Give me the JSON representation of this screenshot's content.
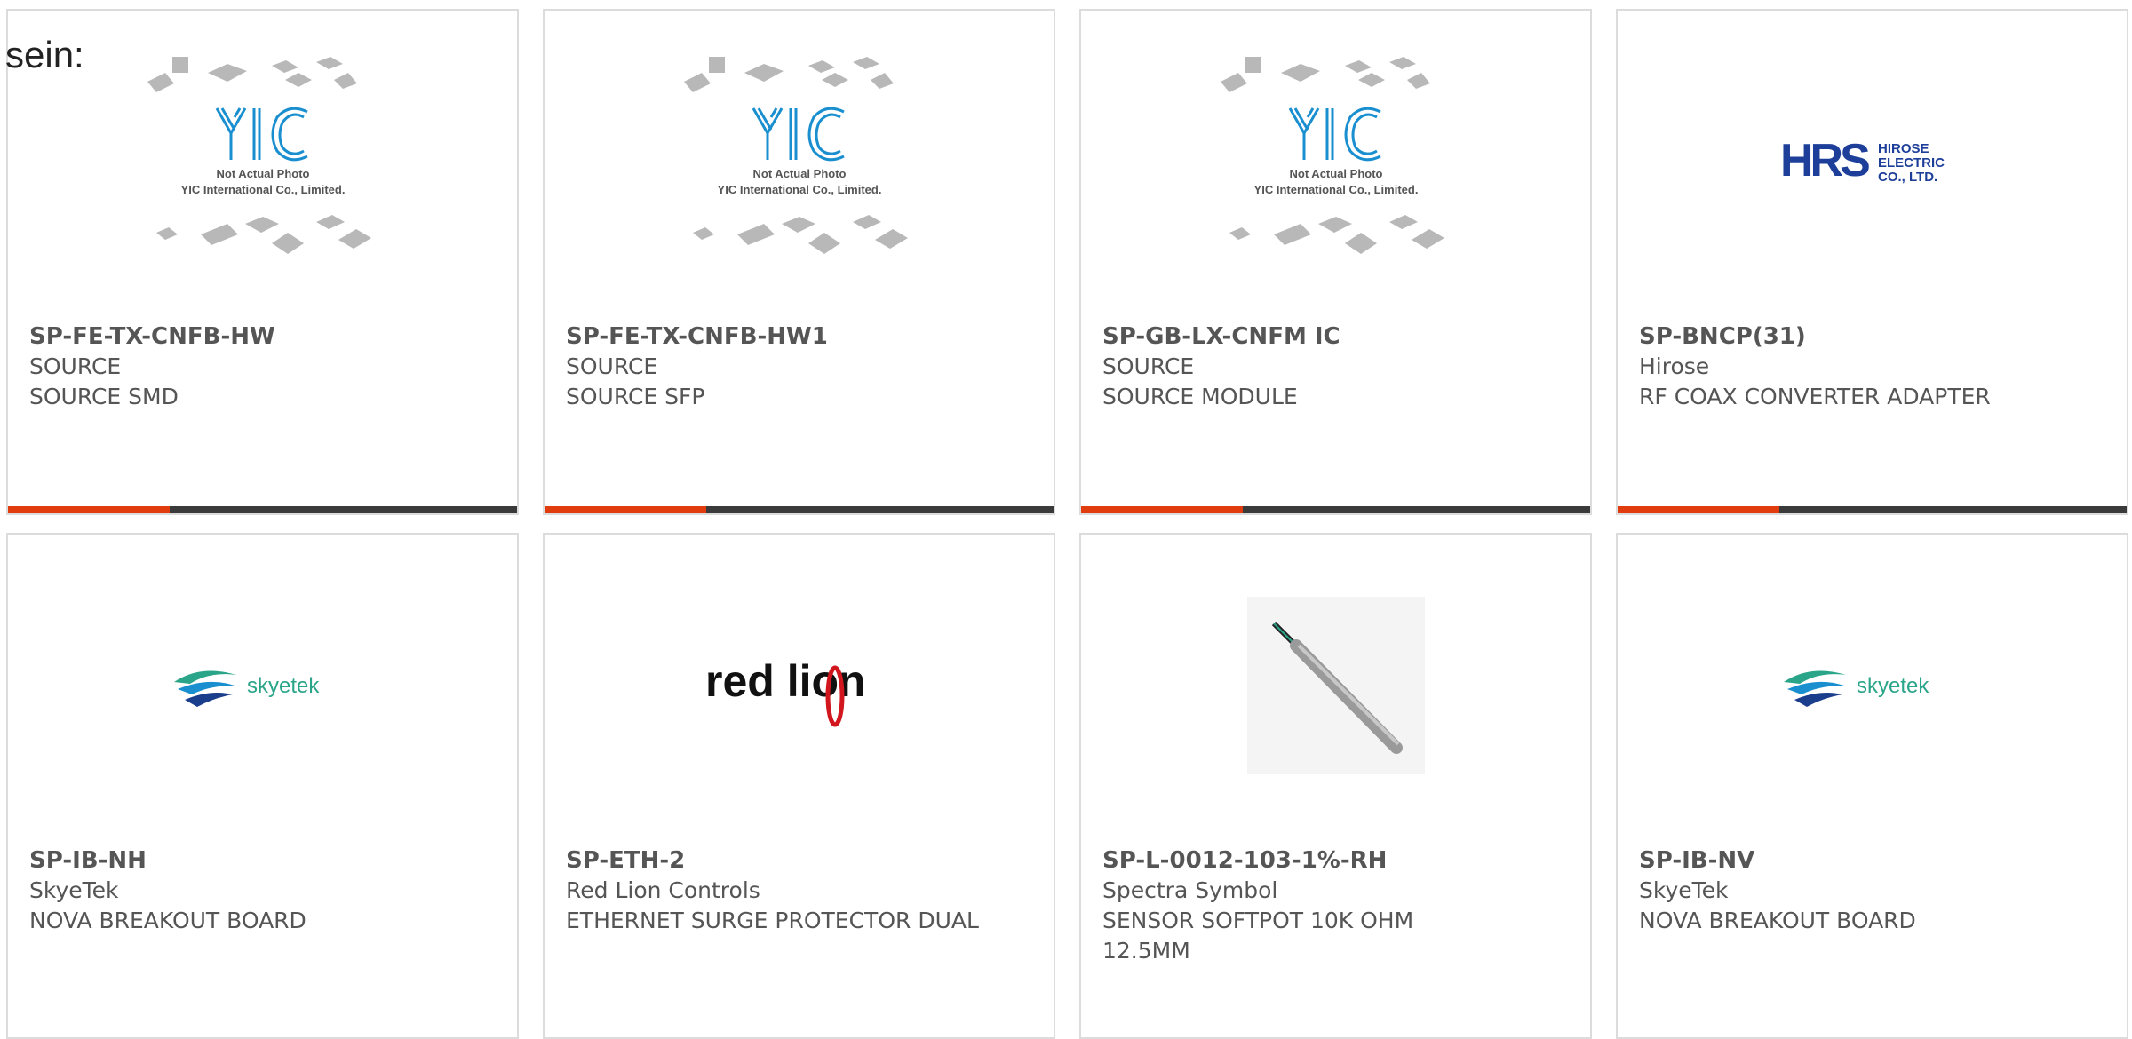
{
  "header": {
    "lead_text": "sein:"
  },
  "products": [
    {
      "part_number": "SP-FE-TX-CNFB-HW",
      "manufacturer": "SOURCE",
      "description": "SOURCE SMD",
      "image": {
        "icon": "yic-placeholder-image",
        "caption_line1": "Not Actual Photo",
        "caption_line2": "YIC International Co., Limited."
      }
    },
    {
      "part_number": "SP-FE-TX-CNFB-HW1",
      "manufacturer": "SOURCE",
      "description": "SOURCE SFP",
      "image": {
        "icon": "yic-placeholder-image",
        "caption_line1": "Not Actual Photo",
        "caption_line2": "YIC International Co., Limited."
      }
    },
    {
      "part_number": "SP-GB-LX-CNFM IC",
      "manufacturer": "SOURCE",
      "description": "SOURCE MODULE",
      "image": {
        "icon": "yic-placeholder-image",
        "caption_line1": "Not Actual Photo",
        "caption_line2": "YIC International Co., Limited."
      }
    },
    {
      "part_number": "SP-BNCP(31)",
      "manufacturer": "Hirose",
      "description": "RF COAX CONVERTER ADAPTER",
      "image": {
        "icon": "hirose-logo",
        "logo_text": "HRS",
        "logo_sub1": "HIROSE",
        "logo_sub2": "ELECTRIC",
        "logo_sub3": "CO., LTD."
      }
    },
    {
      "part_number": "SP-IB-NH",
      "manufacturer": "SkyeTek",
      "description": "NOVA BREAKOUT BOARD",
      "image": {
        "icon": "skyetek-logo",
        "logo_text": "skyetek"
      }
    },
    {
      "part_number": "SP-ETH-2",
      "manufacturer": "Red Lion Controls",
      "description": "ETHERNET SURGE PROTECTOR DUAL",
      "image": {
        "icon": "red-lion-logo",
        "logo_text": "red lion"
      }
    },
    {
      "part_number": "SP-L-0012-103-1%-RH",
      "manufacturer": "Spectra Symbol",
      "description": "SENSOR SOFTPOT 10K OHM 12.5MM",
      "image": {
        "icon": "softpot-sensor-photo"
      }
    },
    {
      "part_number": "SP-IB-NV",
      "manufacturer": "SkyeTek",
      "description": "NOVA BREAKOUT BOARD",
      "image": {
        "icon": "skyetek-logo",
        "logo_text": "skyetek"
      }
    }
  ],
  "colors": {
    "accent": "#e03c0e",
    "bar": "#3a3a3a",
    "border": "#dcdcdc",
    "text": "#555555",
    "yic_blue": "#1a8fd0",
    "hirose_blue": "#1d3f9a",
    "skyetek_green": "#2aa58a",
    "redlion_red": "#d2161e"
  }
}
